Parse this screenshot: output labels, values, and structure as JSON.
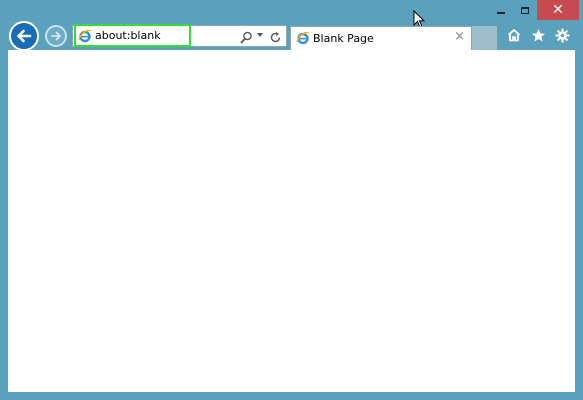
{
  "window": {
    "controls": {
      "minimize_icon": "minimize-icon",
      "maximize_icon": "maximize-icon",
      "close_label": "✕"
    },
    "frame_color": "#5ba1bd",
    "close_color": "#c74a50"
  },
  "nav": {
    "back_icon": "back-arrow-icon",
    "forward_icon": "forward-arrow-icon",
    "back_color": "#1a6cb8"
  },
  "addressbar": {
    "url": "about:blank",
    "icons": [
      "ie-logo-icon",
      "search-icon",
      "dropdown-icon",
      "refresh-icon"
    ],
    "highlight_color": "#33dd33"
  },
  "tabs": [
    {
      "title": "Blank Page",
      "close_label": "×",
      "icon": "ie-logo-icon"
    }
  ],
  "toolbar": {
    "icons": [
      "home-icon",
      "favorites-star-icon",
      "settings-gear-icon"
    ]
  }
}
